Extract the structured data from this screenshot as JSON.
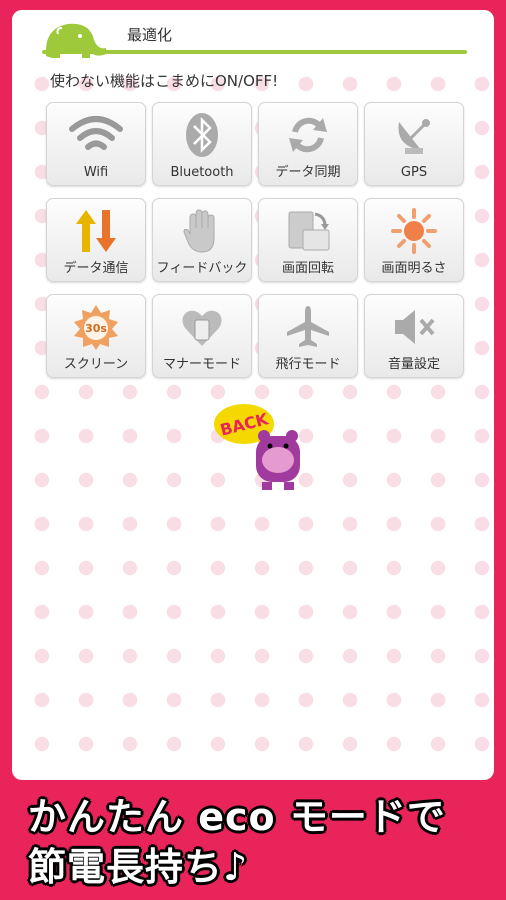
{
  "header": {
    "title": "最適化"
  },
  "subtitle": "使わない機能はこまめにON/OFF!",
  "tiles": [
    {
      "label": "Wifi",
      "icon": "wifi-icon"
    },
    {
      "label": "Bluetooth",
      "icon": "bluetooth-icon"
    },
    {
      "label": "データ同期",
      "icon": "sync-icon"
    },
    {
      "label": "GPS",
      "icon": "satellite-dish-icon"
    },
    {
      "label": "データ通信",
      "icon": "data-arrows-icon"
    },
    {
      "label": "フィードバック",
      "icon": "hand-icon"
    },
    {
      "label": "画面回転",
      "icon": "rotate-screen-icon"
    },
    {
      "label": "画面明るさ",
      "icon": "sun-icon"
    },
    {
      "label": "スクリーン",
      "icon": "timeout-30s-icon",
      "badge": "30s"
    },
    {
      "label": "マナーモード",
      "icon": "manner-mode-icon"
    },
    {
      "label": "飛行モード",
      "icon": "airplane-icon"
    },
    {
      "label": "音量設定",
      "icon": "speaker-mute-icon"
    }
  ],
  "back": {
    "label": "BACK"
  },
  "banner": {
    "line1": "かんたん eco モードで",
    "line2": "節電長持ち♪"
  },
  "colors": {
    "accent": "#e8245a",
    "green": "#9dc93b",
    "dots": "#f9dde4"
  }
}
